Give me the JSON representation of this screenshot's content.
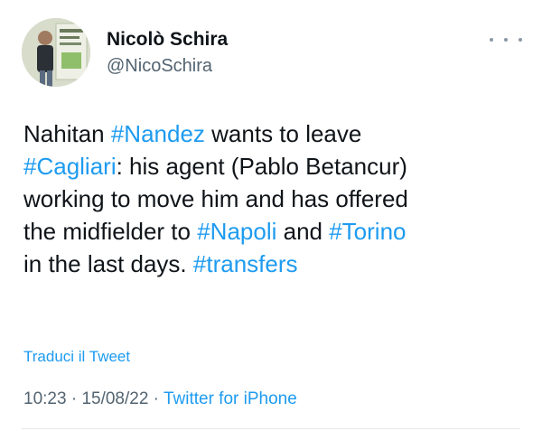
{
  "author": {
    "name": "Nicolò Schira",
    "handle": "@NicoSchira"
  },
  "tweet": {
    "lines": [
      [
        {
          "t": "Nahitan "
        },
        {
          "t": "#Nandez",
          "tag": true
        },
        {
          "t": " wants to leave"
        }
      ],
      [
        {
          "t": "#Cagliari",
          "tag": true
        },
        {
          "t": ": his agent (Pablo Betancur)"
        }
      ],
      [
        {
          "t": "working to move him and has offered"
        }
      ],
      [
        {
          "t": "the midfielder to "
        },
        {
          "t": "#Napoli",
          "tag": true
        },
        {
          "t": " and "
        },
        {
          "t": "#Torino",
          "tag": true
        }
      ],
      [
        {
          "t": "in the last days. "
        },
        {
          "t": "#transfers",
          "tag": true
        }
      ]
    ]
  },
  "translate_label": "Traduci il Tweet",
  "meta": {
    "time": "10:23",
    "separator": " · ",
    "date": "15/08/22",
    "source": "Twitter for iPhone"
  },
  "colors": {
    "link": "#1d9bf0",
    "secondary_text": "#536471",
    "primary_text": "#0f1419"
  },
  "icons": {
    "more": "three-dots-horizontal"
  }
}
